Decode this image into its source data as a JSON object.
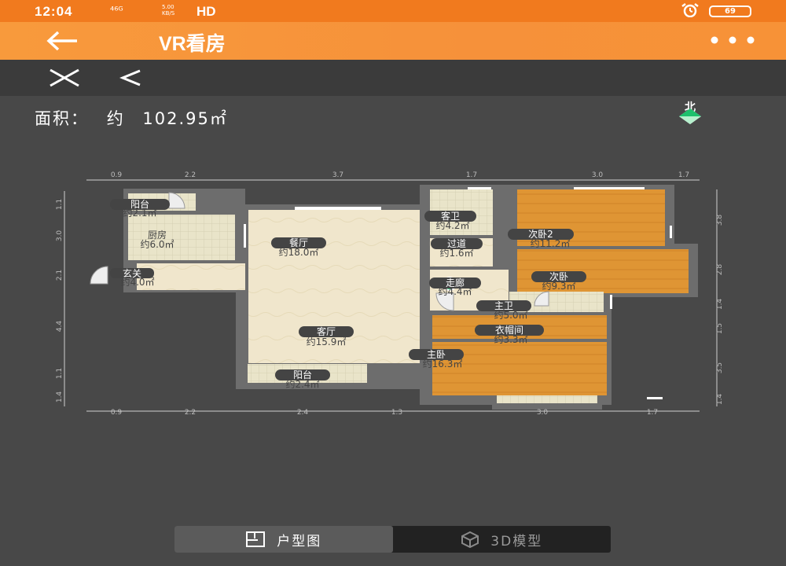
{
  "status_bar": {
    "time": "12:04",
    "network": "⁴⁶ᴳ",
    "speed_value": "5.00",
    "speed_unit": "KB/S",
    "hd": "HD",
    "battery": "69"
  },
  "app_bar": {
    "title": "VR看房"
  },
  "area": {
    "label": "面积：",
    "approx": "约",
    "value": "102.95㎡"
  },
  "compass": {
    "north": "北"
  },
  "floorplan": {
    "rooms": [
      {
        "name": "阳台",
        "area": "约2.1㎡"
      },
      {
        "name": "厨房",
        "area": "约6.0㎡"
      },
      {
        "name": "玄关",
        "area": "约4.0㎡"
      },
      {
        "name": "餐厅",
        "area": "约18.0㎡"
      },
      {
        "name": "客厅",
        "area": "约15.9㎡"
      },
      {
        "name": "阳台",
        "area": "约2.4㎡"
      },
      {
        "name": "客卫",
        "area": "约4.2㎡"
      },
      {
        "name": "过道",
        "area": "约1.6㎡"
      },
      {
        "name": "走廊",
        "area": "约4.4㎡"
      },
      {
        "name": "次卧2",
        "area": "约11.2㎡"
      },
      {
        "name": "次卧",
        "area": "约9.3㎡"
      },
      {
        "name": "主卫",
        "area": "约5.0㎡"
      },
      {
        "name": "衣帽间",
        "area": "约3.3㎡"
      },
      {
        "name": "主卧",
        "area": "约16.3㎡"
      }
    ],
    "bottom_dimensions": [
      "0.9",
      "2.2",
      "2.4",
      "1.3",
      "3.0",
      "1.7"
    ],
    "top_dimensions": [
      "0.9",
      "2.2",
      "3.7",
      "1.7",
      "3.0",
      "1.7"
    ],
    "left_dimensions": [
      "1.1",
      "3.0",
      "2.1",
      "4.4",
      "1.1",
      "1.4"
    ],
    "right_dimensions": [
      "3.8",
      "2.8",
      "1.4",
      "1.5",
      "3.5",
      "1.4"
    ]
  },
  "tabs": [
    {
      "label": "户型图",
      "icon": "floorplan-icon",
      "active": true
    },
    {
      "label": "3D模型",
      "icon": "cube-icon",
      "active": false
    }
  ]
}
